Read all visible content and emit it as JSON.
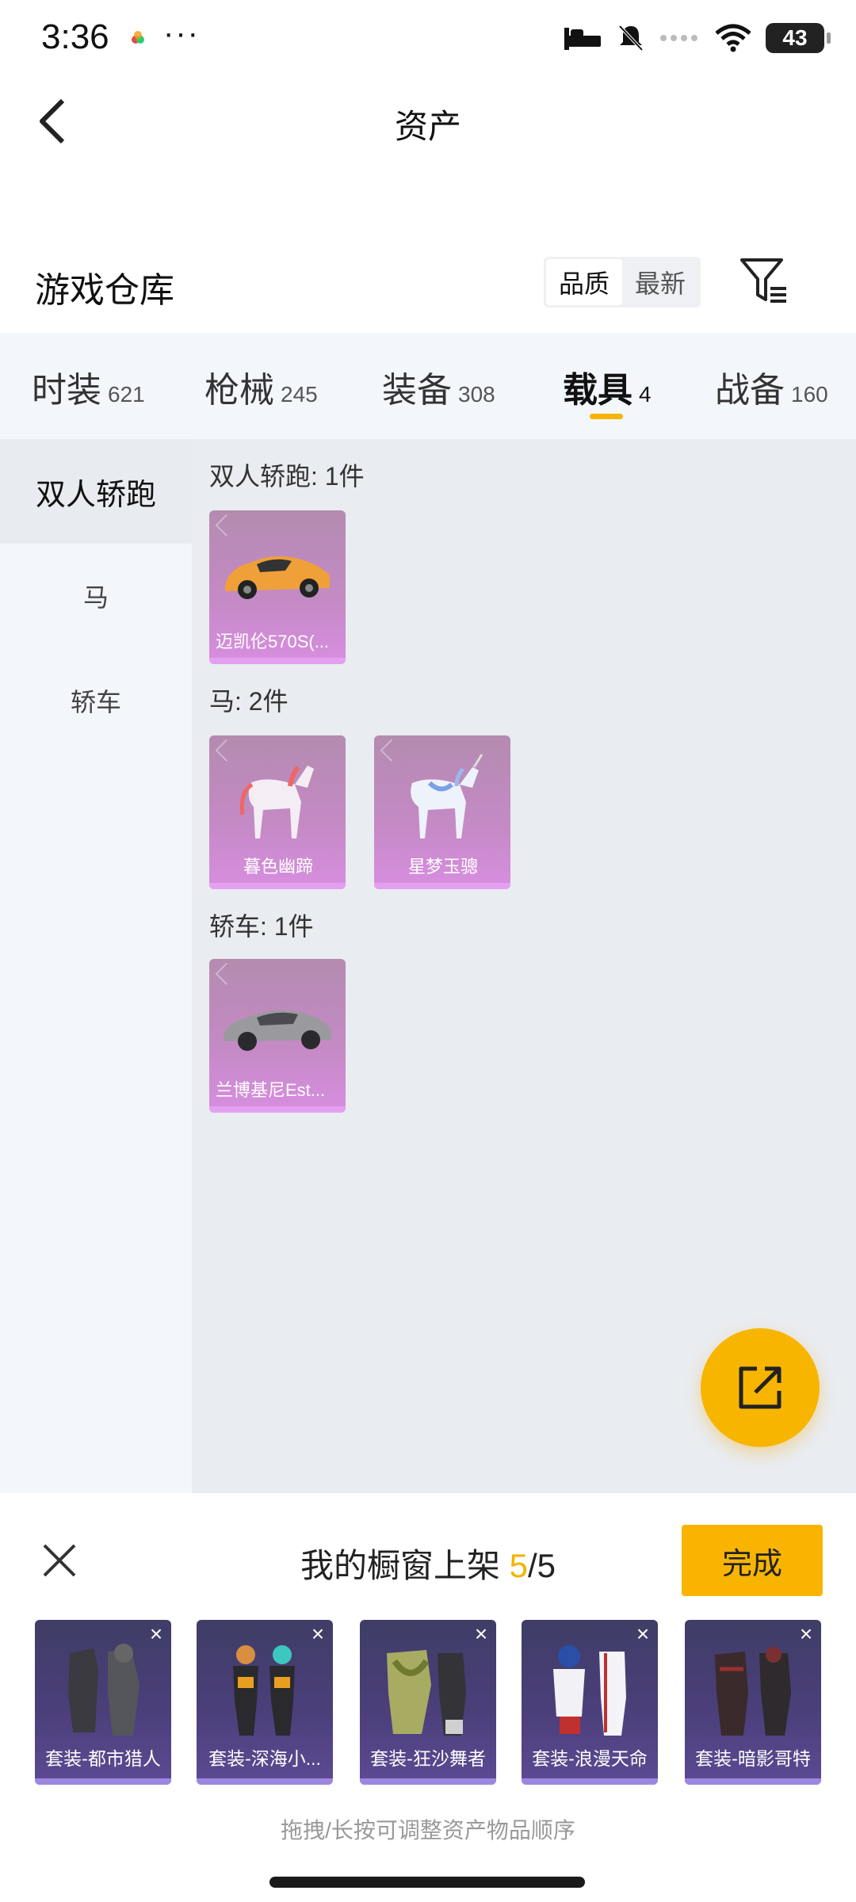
{
  "status": {
    "time": "3:36",
    "more": "···",
    "battery": "43"
  },
  "header": {
    "title": "资产"
  },
  "warehouse": {
    "title": "游戏仓库",
    "sort_options": [
      "品质",
      "最新"
    ],
    "active_sort": "品质"
  },
  "tabs": [
    {
      "label": "时装",
      "count": "621"
    },
    {
      "label": "枪械",
      "count": "245"
    },
    {
      "label": "装备",
      "count": "308"
    },
    {
      "label": "载具",
      "count": "4"
    },
    {
      "label": "战备",
      "count": "160"
    }
  ],
  "active_tab": "载具",
  "sidebar": [
    {
      "label": "双人轿跑"
    },
    {
      "label": "马"
    },
    {
      "label": "轿车"
    }
  ],
  "groups": [
    {
      "title": "双人轿跑: 1件",
      "items": [
        {
          "name": "迈凯伦570S(...",
          "icon": "sports-car-orange"
        }
      ]
    },
    {
      "title": "马: 2件",
      "items": [
        {
          "name": "暮色幽蹄",
          "icon": "horse-pink"
        },
        {
          "name": "星梦玉骢",
          "icon": "unicorn-blue"
        }
      ]
    },
    {
      "title": "轿车: 1件",
      "items": [
        {
          "name": "兰博基尼Est...",
          "icon": "sedan-grey"
        }
      ]
    }
  ],
  "sheet": {
    "title_prefix": "我的橱窗上架 ",
    "count_current": "5",
    "count_total": "/5",
    "done_label": "完成",
    "slots": [
      {
        "name": "套装-都市猎人"
      },
      {
        "name": "套装-深海小..."
      },
      {
        "name": "套装-狂沙舞者"
      },
      {
        "name": "套装-浪漫天命"
      },
      {
        "name": "套装-暗影哥特"
      }
    ],
    "remove_glyph": "×",
    "hint": "拖拽/长按可调整资产物品顺序"
  },
  "colors": {
    "accent": "#f8b400",
    "card_purple": "#c58ac6",
    "slot_purple": "#4b3f7a"
  }
}
